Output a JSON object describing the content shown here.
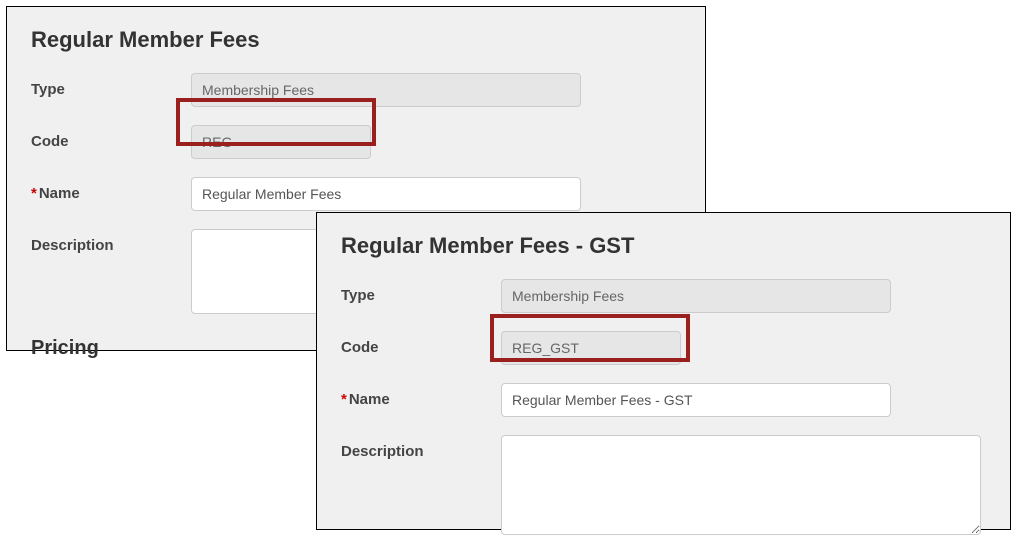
{
  "panel1": {
    "title": "Regular Member Fees",
    "labels": {
      "type": "Type",
      "code": "Code",
      "name": "Name",
      "description": "Description"
    },
    "values": {
      "type": "Membership Fees",
      "code": "REG",
      "name": "Regular Member Fees",
      "description": ""
    },
    "section_next": "Pricing"
  },
  "panel2": {
    "title": "Regular Member Fees - GST",
    "labels": {
      "type": "Type",
      "code": "Code",
      "name": "Name",
      "description": "Description"
    },
    "values": {
      "type": "Membership Fees",
      "code": "REG_GST",
      "name": "Regular Member Fees - GST",
      "description": ""
    }
  }
}
